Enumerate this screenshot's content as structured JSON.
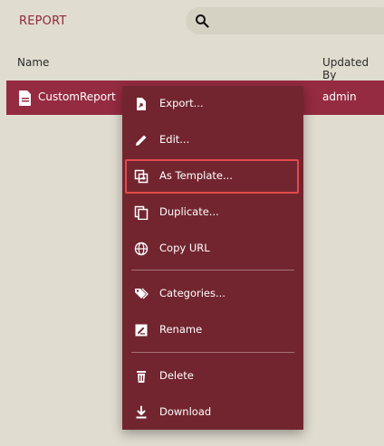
{
  "header": {
    "title": "REPORT",
    "search": {
      "placeholder": ""
    }
  },
  "table": {
    "columns": {
      "name": "Name",
      "updated_by": "Updated By"
    },
    "rows": [
      {
        "name": "CustomReport",
        "updated_by": "admin"
      }
    ]
  },
  "context_menu": {
    "items": [
      {
        "label": "Export...",
        "icon": "export-icon"
      },
      {
        "label": "Edit...",
        "icon": "pencil-icon"
      },
      {
        "label": "As Template...",
        "icon": "template-icon",
        "highlighted": true
      },
      {
        "label": "Duplicate...",
        "icon": "duplicate-icon"
      },
      {
        "label": "Copy URL",
        "icon": "globe-icon"
      },
      {
        "label": "Categories...",
        "icon": "tags-icon"
      },
      {
        "label": "Rename",
        "icon": "rename-icon"
      },
      {
        "label": "Delete",
        "icon": "trash-icon"
      },
      {
        "label": "Download",
        "icon": "download-icon"
      }
    ]
  },
  "colors": {
    "background": "#e0dccf",
    "accent": "#8c2b3a",
    "selected_row": "#952b40",
    "menu_background": "#72252f",
    "highlight_border": "#e34a4a"
  }
}
